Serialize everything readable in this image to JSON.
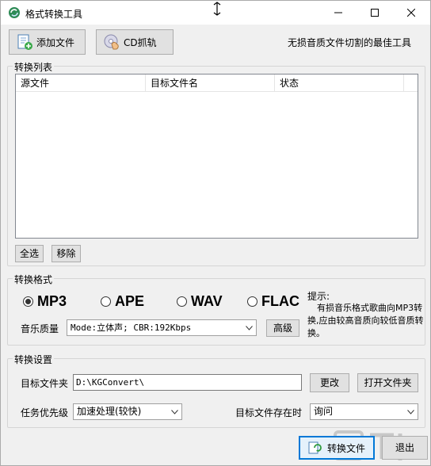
{
  "window": {
    "title": "格式转换工具",
    "controls": [
      "minimize",
      "maximize",
      "close"
    ]
  },
  "toolbar": {
    "add_file_label": "添加文件",
    "add_file_icon": "add-file-icon",
    "cd_rip_label": "CD抓轨",
    "cd_rip_icon": "cd-hand-icon",
    "tagline": "无损音质文件切割的最佳工具"
  },
  "conversion_list": {
    "group_title": "转换列表",
    "columns": [
      "源文件",
      "目标文件名",
      "状态"
    ],
    "rows": [],
    "select_all_label": "全选",
    "remove_label": "移除"
  },
  "format": {
    "group_title": "转换格式",
    "options": [
      {
        "label": "MP3",
        "selected": true
      },
      {
        "label": "APE",
        "selected": false
      },
      {
        "label": "WAV",
        "selected": false
      },
      {
        "label": "FLAC",
        "selected": false
      }
    ],
    "quality_label": "音乐质量",
    "quality_value": "Mode:立体声; CBR:192Kbps",
    "advanced_label": "高级",
    "tip_title": "提示:",
    "tip_body": "有损音乐格式歌曲向MP3转换,应由较高音质向较低音质转换。"
  },
  "settings": {
    "group_title": "转换设置",
    "target_folder_label": "目标文件夹",
    "target_folder_value": "D:\\KGConvert\\",
    "change_label": "更改",
    "open_folder_label": "打开文件夹",
    "priority_label": "任务优先级",
    "priority_value": "加速处理(较快)",
    "exists_label": "目标文件存在时",
    "exists_value": "询问"
  },
  "footer": {
    "convert_label": "转换文件",
    "convert_icon": "convert-icon",
    "exit_label": "退出"
  },
  "colors": {
    "window_bg": "#f0f0f0",
    "button_bg": "#e1e1e1",
    "default_button_border": "#0078d7",
    "default_button_bg": "#e5f1fb"
  }
}
